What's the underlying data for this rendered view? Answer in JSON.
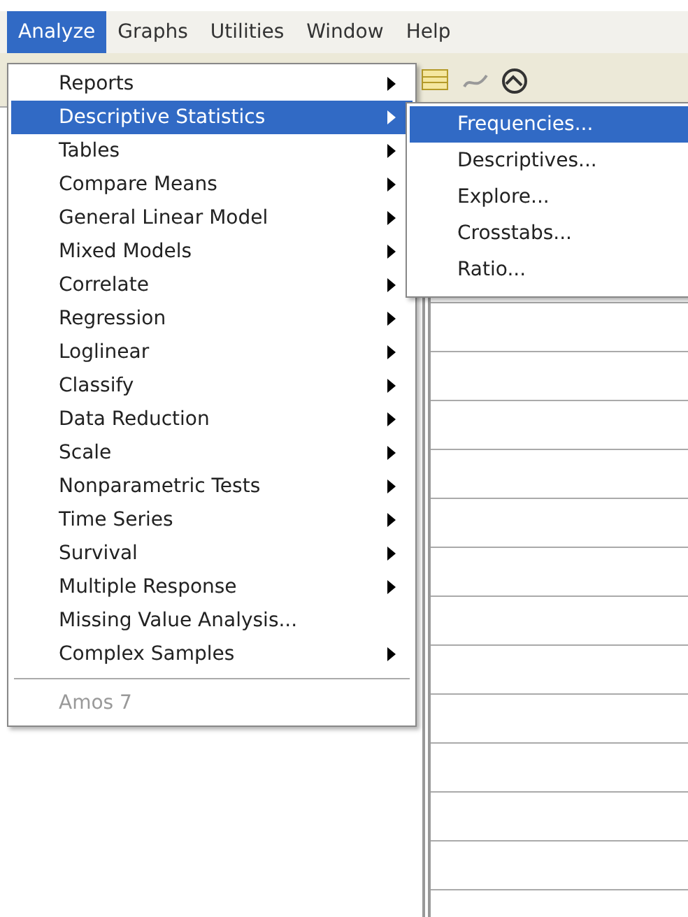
{
  "menu_bar": [
    {
      "label": "Analyze",
      "selected": true
    },
    {
      "label": "Graphs",
      "selected": false
    },
    {
      "label": "Utilities",
      "selected": false
    },
    {
      "label": "Window",
      "selected": false
    },
    {
      "label": "Help",
      "selected": false
    }
  ],
  "menu": {
    "items": [
      {
        "kind": "item",
        "label": "Reports",
        "has_submenu": true,
        "selected": false,
        "disabled": false
      },
      {
        "kind": "item",
        "label": "Descriptive Statistics",
        "has_submenu": true,
        "selected": true,
        "disabled": false
      },
      {
        "kind": "item",
        "label": "Tables",
        "has_submenu": true,
        "selected": false,
        "disabled": false
      },
      {
        "kind": "item",
        "label": "Compare Means",
        "has_submenu": true,
        "selected": false,
        "disabled": false
      },
      {
        "kind": "item",
        "label": "General Linear Model",
        "has_submenu": true,
        "selected": false,
        "disabled": false
      },
      {
        "kind": "item",
        "label": "Mixed Models",
        "has_submenu": true,
        "selected": false,
        "disabled": false
      },
      {
        "kind": "item",
        "label": "Correlate",
        "has_submenu": true,
        "selected": false,
        "disabled": false
      },
      {
        "kind": "item",
        "label": "Regression",
        "has_submenu": true,
        "selected": false,
        "disabled": false
      },
      {
        "kind": "item",
        "label": "Loglinear",
        "has_submenu": true,
        "selected": false,
        "disabled": false
      },
      {
        "kind": "item",
        "label": "Classify",
        "has_submenu": true,
        "selected": false,
        "disabled": false
      },
      {
        "kind": "item",
        "label": "Data Reduction",
        "has_submenu": true,
        "selected": false,
        "disabled": false
      },
      {
        "kind": "item",
        "label": "Scale",
        "has_submenu": true,
        "selected": false,
        "disabled": false
      },
      {
        "kind": "item",
        "label": "Nonparametric Tests",
        "has_submenu": true,
        "selected": false,
        "disabled": false
      },
      {
        "kind": "item",
        "label": "Time Series",
        "has_submenu": true,
        "selected": false,
        "disabled": false
      },
      {
        "kind": "item",
        "label": "Survival",
        "has_submenu": true,
        "selected": false,
        "disabled": false
      },
      {
        "kind": "item",
        "label": "Multiple Response",
        "has_submenu": true,
        "selected": false,
        "disabled": false
      },
      {
        "kind": "item",
        "label": "Missing Value Analysis...",
        "has_submenu": false,
        "selected": false,
        "disabled": false
      },
      {
        "kind": "item",
        "label": "Complex Samples",
        "has_submenu": true,
        "selected": false,
        "disabled": false
      },
      {
        "kind": "separator"
      },
      {
        "kind": "item",
        "label": "Amos 7",
        "has_submenu": false,
        "selected": false,
        "disabled": true
      }
    ]
  },
  "submenu": {
    "items": [
      {
        "label": "Frequencies...",
        "selected": true
      },
      {
        "label": "Descriptives...",
        "selected": false
      },
      {
        "label": "Explore...",
        "selected": false
      },
      {
        "label": "Crosstabs...",
        "selected": false
      },
      {
        "label": "Ratio...",
        "selected": false
      }
    ]
  }
}
